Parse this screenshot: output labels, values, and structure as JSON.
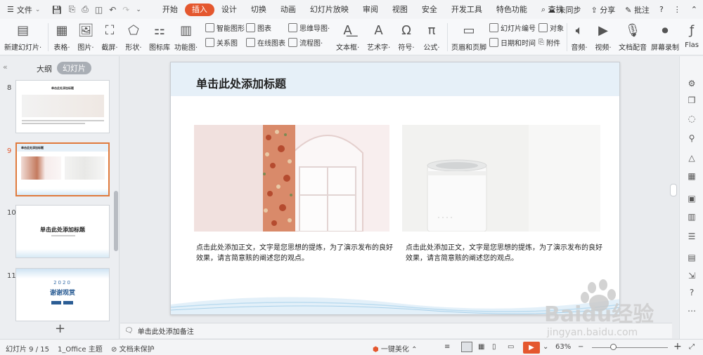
{
  "menubar": {
    "file_label": "文件",
    "tabs": [
      {
        "label": "开始"
      },
      {
        "label": "插入"
      },
      {
        "label": "设计"
      },
      {
        "label": "切换"
      },
      {
        "label": "动画"
      },
      {
        "label": "幻灯片放映"
      },
      {
        "label": "审阅"
      },
      {
        "label": "视图"
      },
      {
        "label": "安全"
      },
      {
        "label": "开发工具"
      },
      {
        "label": "特色功能"
      },
      {
        "label": "查找"
      }
    ],
    "active_tab": "插入",
    "sync_label": "未同步",
    "share_label": "分享",
    "comment_label": "批注"
  },
  "ribbon": {
    "buttons": [
      {
        "label": "新建幻灯片·"
      },
      {
        "label": "表格·"
      },
      {
        "label": "图片·"
      },
      {
        "label": "截屏·"
      },
      {
        "label": "形状·"
      },
      {
        "label": "图标库"
      },
      {
        "label": "功能图·"
      },
      {
        "label": "文本框·"
      },
      {
        "label": "艺术字·"
      },
      {
        "label": "符号·"
      },
      {
        "label": "公式·"
      },
      {
        "label": "页眉和页脚"
      },
      {
        "label": "音频·"
      },
      {
        "label": "视频·"
      },
      {
        "label": "文档配音"
      },
      {
        "label": "屏幕录制"
      },
      {
        "label": "Flas"
      }
    ],
    "small": {
      "smartart": "智能图形",
      "chart": "图表",
      "mindmap": "思维导图·",
      "relation": "关系图",
      "online_chart": "在线图表",
      "flowchart": "流程图·",
      "slide_number": "幻灯片编号",
      "object": "对象",
      "datetime": "日期和时间",
      "attachment": "附件"
    }
  },
  "leftpanel": {
    "tabs": [
      {
        "label": "大纲"
      },
      {
        "label": "幻灯片"
      }
    ],
    "thumbnails": [
      {
        "num": "8",
        "title": "单击此处添加标题"
      },
      {
        "num": "9",
        "title": "单击此处添加标题"
      },
      {
        "num": "10",
        "title": "单击此处添加标题"
      },
      {
        "num": "11",
        "year": "2020",
        "title": "谢谢观赏"
      }
    ],
    "add_label": "+"
  },
  "slide": {
    "title": "单击此处添加标题",
    "text_left": "点击此处添加正文，文字是您思想的提炼，为了演示发布的良好效果，请言简意赅的阐述您的观点。",
    "text_right": "点击此处添加正文，文字是您思想的提炼，为了演示发布的良好效果，请言简意赅的阐述您的观点。"
  },
  "notes": {
    "placeholder": "单击此处添加备注"
  },
  "statusbar": {
    "slide_pos": "幻灯片 9 / 15",
    "theme": "1_Office 主题",
    "protect": "文档未保护",
    "beautify": "一键美化",
    "zoom": "63%"
  },
  "watermark": {
    "brand": "Baidu经验",
    "url": "jingyan.baidu.com"
  },
  "colors": {
    "accent": "#e4572e",
    "header_band": "#e6f0f8",
    "active_thumb_border": "#e07a3c"
  }
}
